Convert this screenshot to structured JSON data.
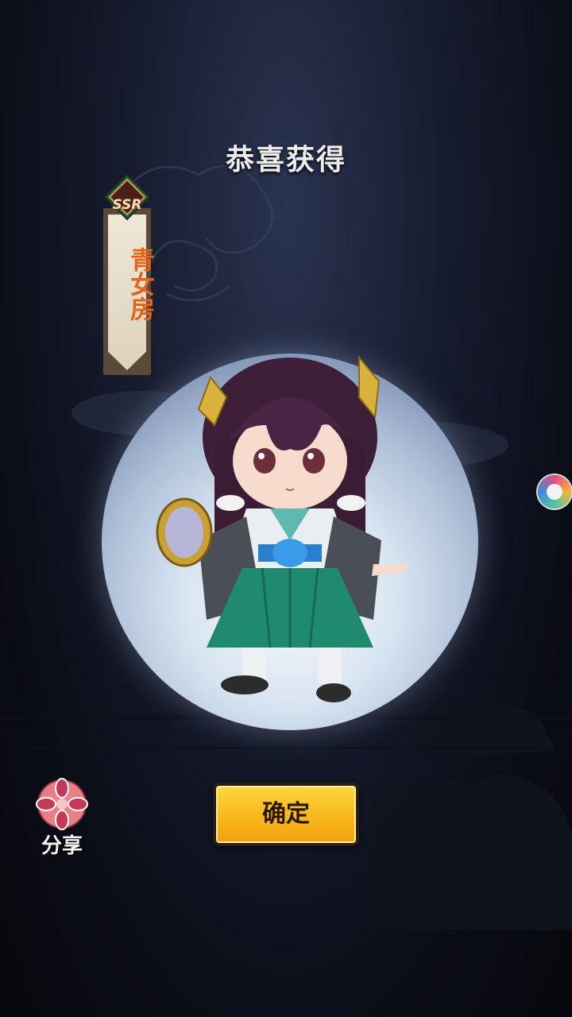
{
  "header": {
    "title": "恭喜获得"
  },
  "reward": {
    "rarity": "SSR",
    "name": "青女房"
  },
  "actions": {
    "share_label": "分享",
    "confirm_label": "确定"
  },
  "icons": {
    "share": "share-flower-icon",
    "floating": "floating-ball-icon"
  },
  "colors": {
    "button": "#f8b81a",
    "name_text": "#e1661d",
    "title_text": "#ececec"
  }
}
